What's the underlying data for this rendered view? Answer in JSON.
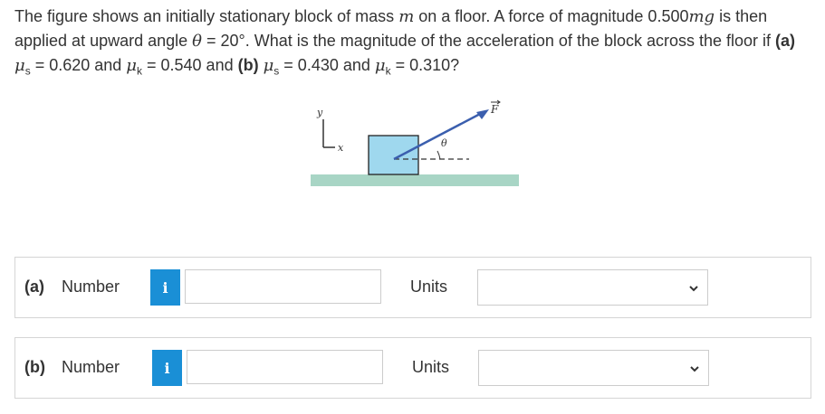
{
  "question": {
    "s1": "The figure shows an initially stationary block of mass ",
    "m": "m",
    "s2": " on a floor. A force of magnitude 0.500",
    "mg": "mg",
    "s3": " is then applied at upward angle ",
    "theta": "θ",
    "s4": " = 20°. What is the magnitude of the acceleration of the block across the floor if ",
    "a_label": "(a)",
    "mu1": "μ",
    "s1sub": "s",
    "v1": " = 0.620 and ",
    "mu2": "μ",
    "k1sub": "k",
    "v2": " = 0.540 and ",
    "b_label": "(b)",
    "mu3": "μ",
    "s2sub": "s",
    "v3": " = 0.430 and ",
    "mu4": "μ",
    "k2sub": "k",
    "v4": " = 0.310?"
  },
  "figure": {
    "y_axis": "y",
    "x_axis": "x",
    "theta": "θ",
    "force": "F"
  },
  "answers": [
    {
      "part": "(a)",
      "number_label": "Number",
      "info_icon": "i",
      "number_value": "",
      "units_label": "Units",
      "units_value": ""
    },
    {
      "part": "(b)",
      "number_label": "Number",
      "info_icon": "i",
      "number_value": "",
      "units_label": "Units",
      "units_value": ""
    }
  ],
  "colors": {
    "info_button": "#1a8fd6",
    "block": "#9fd8ee",
    "floor": "#a8d5c5",
    "force_arrow": "#3b5fae"
  }
}
